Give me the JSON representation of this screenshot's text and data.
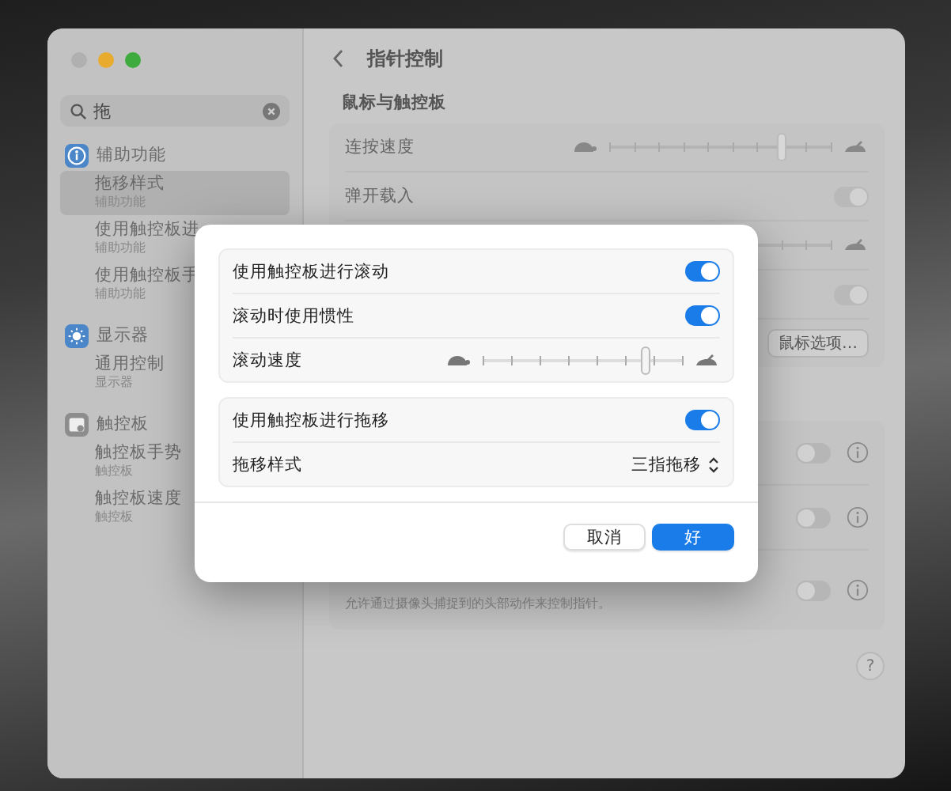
{
  "sidebar": {
    "search": {
      "value": "拖"
    },
    "groups": [
      {
        "label": "辅助功能",
        "items": [
          {
            "title": "拖移样式",
            "subtitle": "辅助功能",
            "selected": true
          },
          {
            "title": "使用触控板进",
            "subtitle": "辅助功能",
            "selected": false
          },
          {
            "title": "使用触控板手",
            "subtitle": "辅助功能",
            "selected": false
          }
        ]
      },
      {
        "label": "显示器",
        "items": [
          {
            "title": "通用控制",
            "subtitle": "显示器",
            "selected": false
          }
        ]
      },
      {
        "label": "触控板",
        "items": [
          {
            "title": "触控板手势",
            "subtitle": "触控板",
            "selected": false
          },
          {
            "title": "触控板速度",
            "subtitle": "触控板",
            "selected": false
          }
        ]
      }
    ]
  },
  "content": {
    "title": "指针控制",
    "section": "鼠标与触控板",
    "cards": [
      [
        {
          "kind": "slider",
          "label": "连按速度",
          "level": 0.78
        },
        {
          "kind": "toggle",
          "label": "弹开载入",
          "on": true
        },
        {
          "kind": "slider"
        },
        {
          "kind": "toggle",
          "on": true
        },
        {
          "kind": "buttons",
          "buttons": [
            "鼠标选项…"
          ]
        }
      ],
      [
        {
          "kind": "toggle",
          "on": false,
          "info": true
        },
        {
          "kind": "toggle",
          "on": false,
          "info": true
        },
        {
          "kind": "toggle",
          "description": "允许通过摄像头捕捉到的头部动作来控制指针。",
          "on": false,
          "info": true
        }
      ]
    ],
    "help": "?"
  },
  "sheet": {
    "groups": [
      [
        {
          "kind": "toggle",
          "label": "使用触控板进行滚动",
          "on": true
        },
        {
          "kind": "toggle",
          "label": "滚动时使用惯性",
          "on": true
        },
        {
          "kind": "slider",
          "label": "滚动速度",
          "level": 0.82
        }
      ],
      [
        {
          "kind": "toggle",
          "label": "使用触控板进行拖移",
          "on": true
        },
        {
          "kind": "popup",
          "label": "拖移样式",
          "value": "三指拖移"
        }
      ]
    ],
    "buttons": [
      {
        "label": "取消",
        "default": false
      },
      {
        "label": "好",
        "default": true
      }
    ]
  }
}
